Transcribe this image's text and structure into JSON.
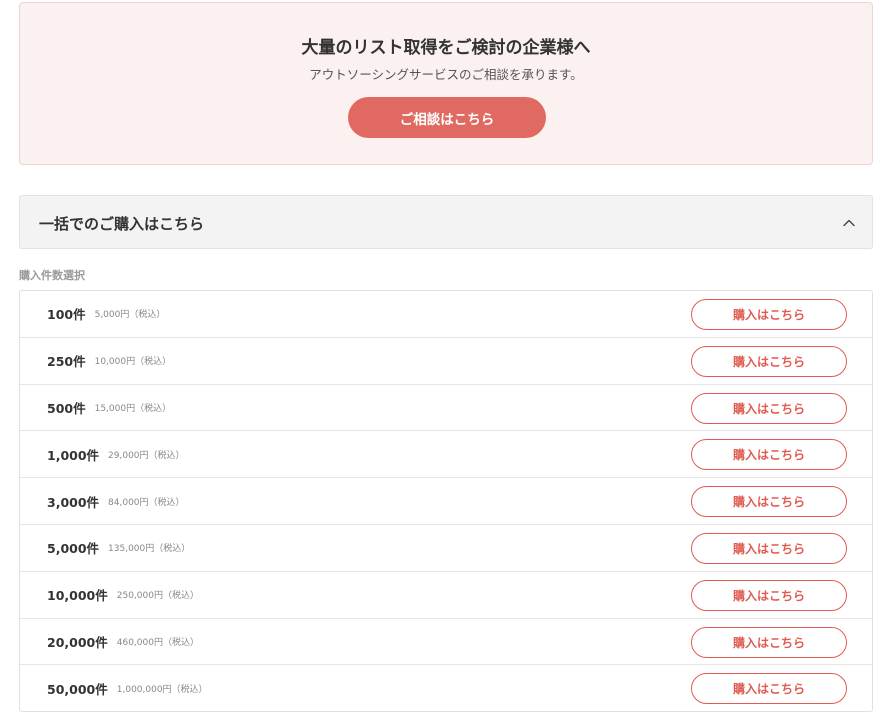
{
  "consult": {
    "title": "大量のリスト取得をご検討の企業様へ",
    "subtitle": "アウトソーシングサービスのご相談を承ります。",
    "button_label": "ご相談はこちら"
  },
  "bulk": {
    "title": "一括でのご購入はこちら",
    "toggle_icon": "chevron-up-icon"
  },
  "selection_label": "購入件数選択",
  "plans": [
    {
      "qty": "100件",
      "price": "5,000円（税込）",
      "button": "購入はこちら"
    },
    {
      "qty": "250件",
      "price": "10,000円（税込）",
      "button": "購入はこちら"
    },
    {
      "qty": "500件",
      "price": "15,000円（税込）",
      "button": "購入はこちら"
    },
    {
      "qty": "1,000件",
      "price": "29,000円（税込）",
      "button": "購入はこちら"
    },
    {
      "qty": "3,000件",
      "price": "84,000円（税込）",
      "button": "購入はこちら"
    },
    {
      "qty": "5,000件",
      "price": "135,000円（税込）",
      "button": "購入はこちら"
    },
    {
      "qty": "10,000件",
      "price": "250,000円（税込）",
      "button": "購入はこちら"
    },
    {
      "qty": "20,000件",
      "price": "460,000円（税込）",
      "button": "購入はこちら"
    },
    {
      "qty": "50,000件",
      "price": "1,000,000円（税込）",
      "button": "購入はこちら"
    }
  ],
  "colors": {
    "accent": "#e06a62",
    "accent_border": "#e05c52",
    "consult_bg": "#fbf1f0",
    "header_bg": "#f3f3f3"
  }
}
